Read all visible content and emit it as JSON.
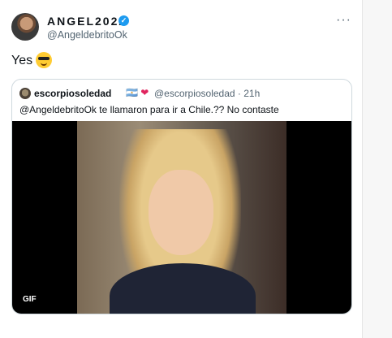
{
  "tweet": {
    "author_name": "ANGEL2022",
    "author_handle": "@AngeldebritoOk",
    "text": "Yes",
    "emoji": "smiling-face-with-sunglasses",
    "more_label": "···"
  },
  "quoted": {
    "name": "escorpiosoledad",
    "flags": "🇦🇷",
    "heart": "❤",
    "handle_time": "@escorpiosoledad · 21h",
    "text": "@AngeldebritoOk te llamaron para ir a Chile.?? No contaste",
    "media_badge": "GIF"
  },
  "colors": {
    "verified": "#1d9bf0",
    "text": "#0f1419",
    "secondary": "#536471",
    "border": "#cfd9de"
  }
}
